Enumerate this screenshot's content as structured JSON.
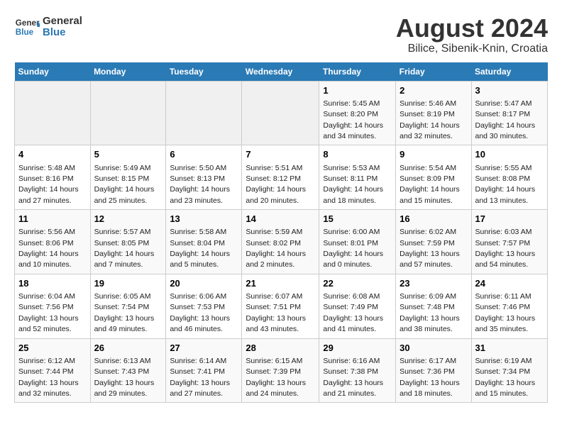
{
  "header": {
    "logo_general": "General",
    "logo_blue": "Blue",
    "title": "August 2024",
    "subtitle": "Bilice, Sibenik-Knin, Croatia"
  },
  "days_of_week": [
    "Sunday",
    "Monday",
    "Tuesday",
    "Wednesday",
    "Thursday",
    "Friday",
    "Saturday"
  ],
  "weeks": [
    [
      {
        "day": "",
        "info": ""
      },
      {
        "day": "",
        "info": ""
      },
      {
        "day": "",
        "info": ""
      },
      {
        "day": "",
        "info": ""
      },
      {
        "day": "1",
        "info": "Sunrise: 5:45 AM\nSunset: 8:20 PM\nDaylight: 14 hours\nand 34 minutes."
      },
      {
        "day": "2",
        "info": "Sunrise: 5:46 AM\nSunset: 8:19 PM\nDaylight: 14 hours\nand 32 minutes."
      },
      {
        "day": "3",
        "info": "Sunrise: 5:47 AM\nSunset: 8:17 PM\nDaylight: 14 hours\nand 30 minutes."
      }
    ],
    [
      {
        "day": "4",
        "info": "Sunrise: 5:48 AM\nSunset: 8:16 PM\nDaylight: 14 hours\nand 27 minutes."
      },
      {
        "day": "5",
        "info": "Sunrise: 5:49 AM\nSunset: 8:15 PM\nDaylight: 14 hours\nand 25 minutes."
      },
      {
        "day": "6",
        "info": "Sunrise: 5:50 AM\nSunset: 8:13 PM\nDaylight: 14 hours\nand 23 minutes."
      },
      {
        "day": "7",
        "info": "Sunrise: 5:51 AM\nSunset: 8:12 PM\nDaylight: 14 hours\nand 20 minutes."
      },
      {
        "day": "8",
        "info": "Sunrise: 5:53 AM\nSunset: 8:11 PM\nDaylight: 14 hours\nand 18 minutes."
      },
      {
        "day": "9",
        "info": "Sunrise: 5:54 AM\nSunset: 8:09 PM\nDaylight: 14 hours\nand 15 minutes."
      },
      {
        "day": "10",
        "info": "Sunrise: 5:55 AM\nSunset: 8:08 PM\nDaylight: 14 hours\nand 13 minutes."
      }
    ],
    [
      {
        "day": "11",
        "info": "Sunrise: 5:56 AM\nSunset: 8:06 PM\nDaylight: 14 hours\nand 10 minutes."
      },
      {
        "day": "12",
        "info": "Sunrise: 5:57 AM\nSunset: 8:05 PM\nDaylight: 14 hours\nand 7 minutes."
      },
      {
        "day": "13",
        "info": "Sunrise: 5:58 AM\nSunset: 8:04 PM\nDaylight: 14 hours\nand 5 minutes."
      },
      {
        "day": "14",
        "info": "Sunrise: 5:59 AM\nSunset: 8:02 PM\nDaylight: 14 hours\nand 2 minutes."
      },
      {
        "day": "15",
        "info": "Sunrise: 6:00 AM\nSunset: 8:01 PM\nDaylight: 14 hours\nand 0 minutes."
      },
      {
        "day": "16",
        "info": "Sunrise: 6:02 AM\nSunset: 7:59 PM\nDaylight: 13 hours\nand 57 minutes."
      },
      {
        "day": "17",
        "info": "Sunrise: 6:03 AM\nSunset: 7:57 PM\nDaylight: 13 hours\nand 54 minutes."
      }
    ],
    [
      {
        "day": "18",
        "info": "Sunrise: 6:04 AM\nSunset: 7:56 PM\nDaylight: 13 hours\nand 52 minutes."
      },
      {
        "day": "19",
        "info": "Sunrise: 6:05 AM\nSunset: 7:54 PM\nDaylight: 13 hours\nand 49 minutes."
      },
      {
        "day": "20",
        "info": "Sunrise: 6:06 AM\nSunset: 7:53 PM\nDaylight: 13 hours\nand 46 minutes."
      },
      {
        "day": "21",
        "info": "Sunrise: 6:07 AM\nSunset: 7:51 PM\nDaylight: 13 hours\nand 43 minutes."
      },
      {
        "day": "22",
        "info": "Sunrise: 6:08 AM\nSunset: 7:49 PM\nDaylight: 13 hours\nand 41 minutes."
      },
      {
        "day": "23",
        "info": "Sunrise: 6:09 AM\nSunset: 7:48 PM\nDaylight: 13 hours\nand 38 minutes."
      },
      {
        "day": "24",
        "info": "Sunrise: 6:11 AM\nSunset: 7:46 PM\nDaylight: 13 hours\nand 35 minutes."
      }
    ],
    [
      {
        "day": "25",
        "info": "Sunrise: 6:12 AM\nSunset: 7:44 PM\nDaylight: 13 hours\nand 32 minutes."
      },
      {
        "day": "26",
        "info": "Sunrise: 6:13 AM\nSunset: 7:43 PM\nDaylight: 13 hours\nand 29 minutes."
      },
      {
        "day": "27",
        "info": "Sunrise: 6:14 AM\nSunset: 7:41 PM\nDaylight: 13 hours\nand 27 minutes."
      },
      {
        "day": "28",
        "info": "Sunrise: 6:15 AM\nSunset: 7:39 PM\nDaylight: 13 hours\nand 24 minutes."
      },
      {
        "day": "29",
        "info": "Sunrise: 6:16 AM\nSunset: 7:38 PM\nDaylight: 13 hours\nand 21 minutes."
      },
      {
        "day": "30",
        "info": "Sunrise: 6:17 AM\nSunset: 7:36 PM\nDaylight: 13 hours\nand 18 minutes."
      },
      {
        "day": "31",
        "info": "Sunrise: 6:19 AM\nSunset: 7:34 PM\nDaylight: 13 hours\nand 15 minutes."
      }
    ]
  ]
}
